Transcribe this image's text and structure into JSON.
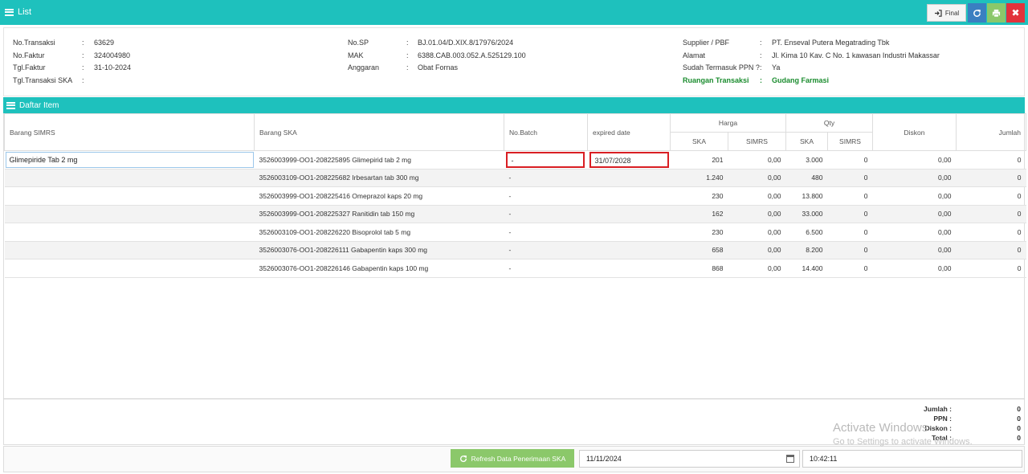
{
  "header": {
    "title": "List",
    "final_label": "Final"
  },
  "info": {
    "left": [
      {
        "label": "No.Transaksi",
        "value": "63629"
      },
      {
        "label": "No.Faktur",
        "value": "324004980"
      },
      {
        "label": "Tgl.Faktur",
        "value": "31-10-2024"
      },
      {
        "label": "Tgl.Transaksi SKA",
        "value": ""
      }
    ],
    "middle": [
      {
        "label": "No.SP",
        "value": "BJ.01.04/D.XIX.8/17976/2024"
      },
      {
        "label": "MAK",
        "value": "6388.CAB.003.052.A.525129.100"
      },
      {
        "label": "Anggaran",
        "value": "Obat Fornas"
      }
    ],
    "right": [
      {
        "label": "Supplier / PBF",
        "value": "PT. Enseval Putera Megatrading Tbk"
      },
      {
        "label": "Alamat",
        "value": "Jl. Kima 10 Kav. C No. 1 kawasan Industri Makassar"
      },
      {
        "label": "Sudah Termasuk PPN ?",
        "value": "Ya"
      },
      {
        "label": "Ruangan Transaksi",
        "value": "Gudang Farmasi"
      }
    ]
  },
  "section": {
    "title": "Daftar Item"
  },
  "table": {
    "headers": {
      "barang_simrs": "Barang SIMRS",
      "barang_ska": "Barang SKA",
      "no_batch": "No.Batch",
      "expired": "expired date",
      "harga": "Harga",
      "qty": "Qty",
      "diskon": "Diskon",
      "jumlah": "Jumlah",
      "ska": "SKA",
      "simrs": "SIMRS"
    },
    "rows": [
      {
        "simrs": "Glimepiride Tab 2 mg",
        "ska": "3526003999-OO1-208225895 Glimepirid tab 2 mg",
        "batch": "-",
        "expired": "31/07/2028",
        "harga_ska": "201",
        "harga_simrs": "0,00",
        "qty_ska": "3.000",
        "qty_simrs": "0",
        "diskon": "0,00",
        "jumlah": "0"
      },
      {
        "simrs": "",
        "ska": "3526003109-OO1-208225682 Irbesartan tab 300 mg",
        "batch": "-",
        "expired": "",
        "harga_ska": "1.240",
        "harga_simrs": "0,00",
        "qty_ska": "480",
        "qty_simrs": "0",
        "diskon": "0,00",
        "jumlah": "0"
      },
      {
        "simrs": "",
        "ska": "3526003999-OO1-208225416 Omeprazol kaps 20 mg",
        "batch": "-",
        "expired": "",
        "harga_ska": "230",
        "harga_simrs": "0,00",
        "qty_ska": "13.800",
        "qty_simrs": "0",
        "diskon": "0,00",
        "jumlah": "0"
      },
      {
        "simrs": "",
        "ska": "3526003999-OO1-208225327 Ranitidin tab 150 mg",
        "batch": "-",
        "expired": "",
        "harga_ska": "162",
        "harga_simrs": "0,00",
        "qty_ska": "33.000",
        "qty_simrs": "0",
        "diskon": "0,00",
        "jumlah": "0"
      },
      {
        "simrs": "",
        "ska": "3526003109-OO1-208226220 Bisoprolol tab 5 mg",
        "batch": "-",
        "expired": "",
        "harga_ska": "230",
        "harga_simrs": "0,00",
        "qty_ska": "6.500",
        "qty_simrs": "0",
        "diskon": "0,00",
        "jumlah": "0"
      },
      {
        "simrs": "",
        "ska": "3526003076-OO1-208226111 Gabapentin kaps 300 mg",
        "batch": "-",
        "expired": "",
        "harga_ska": "658",
        "harga_simrs": "0,00",
        "qty_ska": "8.200",
        "qty_simrs": "0",
        "diskon": "0,00",
        "jumlah": "0"
      },
      {
        "simrs": "",
        "ska": "3526003076-OO1-208226146 Gabapentin kaps 100 mg",
        "batch": "-",
        "expired": "",
        "harga_ska": "868",
        "harga_simrs": "0,00",
        "qty_ska": "14.400",
        "qty_simrs": "0",
        "diskon": "0,00",
        "jumlah": "0"
      }
    ]
  },
  "totals": [
    {
      "label": "Jumlah :",
      "value": "0"
    },
    {
      "label": "PPN :",
      "value": "0"
    },
    {
      "label": "Diskon :",
      "value": "0"
    },
    {
      "label": "Total :",
      "value": "0"
    }
  ],
  "footer": {
    "refresh_label": "Refresh Data Penerimaan SKA",
    "date": "11/11/2024",
    "time": "10:42:11"
  },
  "watermark": {
    "line1": "Activate Windows",
    "line2": "Go to Settings to activate Windows."
  },
  "colors": {
    "accent": "#1ec1bd",
    "refresh": "#3a7fc1",
    "print": "#8bc86a",
    "close": "#e2323b",
    "highlight": "#d91e23",
    "green_text": "#1a8c2e"
  }
}
